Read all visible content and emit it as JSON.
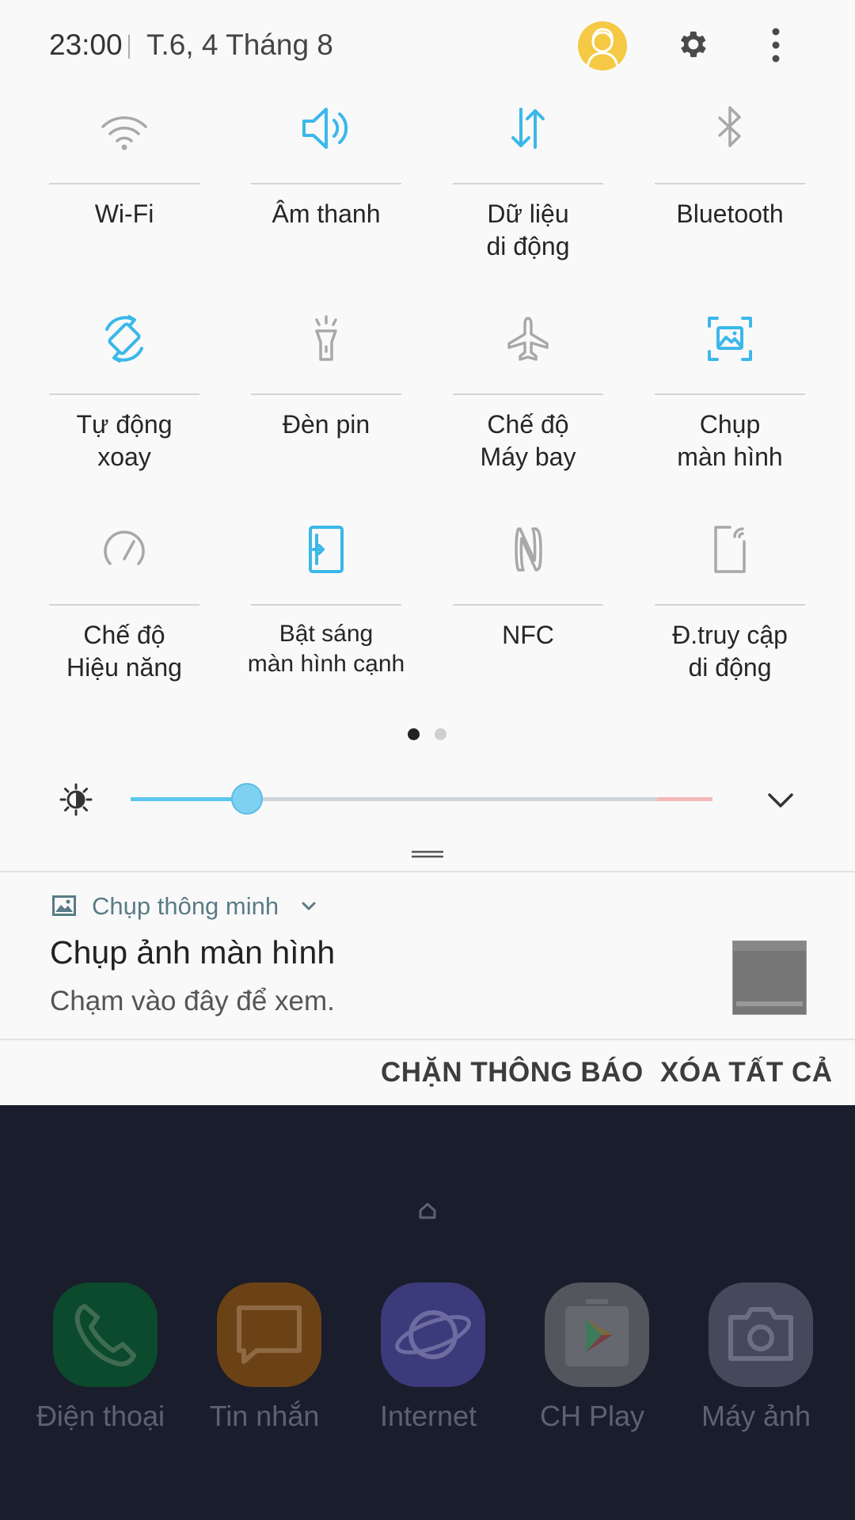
{
  "status": {
    "time": "23:00",
    "date": "T.6, 4 Tháng 8"
  },
  "tiles": [
    {
      "label": "Wi-Fi",
      "icon": "wifi-icon",
      "active": false
    },
    {
      "label": "Âm thanh",
      "icon": "sound-icon",
      "active": true
    },
    {
      "label": "Dữ liệu\ndi động",
      "icon": "mobile-data-icon",
      "active": true
    },
    {
      "label": "Bluetooth",
      "icon": "bluetooth-icon",
      "active": false
    },
    {
      "label": "Tự động\nxoay",
      "icon": "auto-rotate-icon",
      "active": true
    },
    {
      "label": "Đèn pin",
      "icon": "flashlight-icon",
      "active": false
    },
    {
      "label": "Chế độ\nMáy bay",
      "icon": "airplane-icon",
      "active": false
    },
    {
      "label": "Chụp\nmàn hình",
      "icon": "screenshot-icon",
      "active": true
    },
    {
      "label": "Chế độ\nHiệu năng",
      "icon": "performance-icon",
      "active": false
    },
    {
      "label": "Bật sáng\nmàn hình cạnh",
      "icon": "edge-lighting-icon",
      "active": true
    },
    {
      "label": "NFC",
      "icon": "nfc-icon",
      "active": false
    },
    {
      "label": "Đ.truy cập\ndi động",
      "icon": "mobile-hotspot-icon",
      "active": false
    }
  ],
  "pager": {
    "current": 1,
    "total": 2
  },
  "brightness": {
    "level": 0.2
  },
  "notification": {
    "app_name": "Chụp thông minh",
    "title": "Chụp ảnh màn hình",
    "text": "Chạm vào đây để xem."
  },
  "actions": {
    "block": "CHẶN THÔNG BÁO",
    "clear_all": "XÓA TẤT CẢ"
  },
  "dock": [
    {
      "label": "Điện thoại",
      "icon": "phone-icon",
      "color": "#0b4a2c"
    },
    {
      "label": "Tin nhắn",
      "icon": "messages-icon",
      "color": "#6b4215"
    },
    {
      "label": "Internet",
      "icon": "internet-icon",
      "color": "#3b3a7a"
    },
    {
      "label": "CH Play",
      "icon": "play-store-icon",
      "color": "#54565e"
    },
    {
      "label": "Máy ảnh",
      "icon": "camera-icon",
      "color": "#444a5c"
    }
  ],
  "colors": {
    "accent": "#3bb8ea",
    "inactive": "#a8a8a8",
    "panel": "#f9f9f9",
    "home_bg": "#1a1d2c"
  }
}
